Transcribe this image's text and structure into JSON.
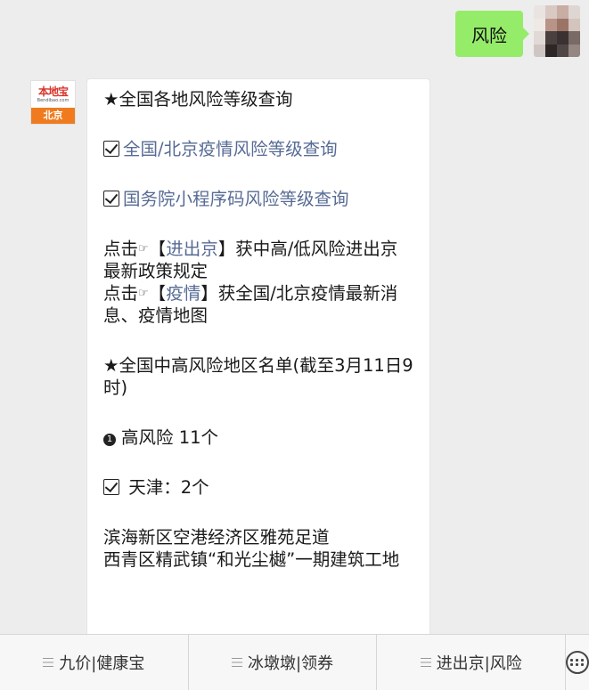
{
  "user_message": {
    "text": "风险"
  },
  "bot": {
    "avatar": {
      "logo_text": "本地宝",
      "logo_sub": "Bendibao.com",
      "city": "北京"
    },
    "message": {
      "title1": "★全国各地风险等级查询",
      "link1": "全国/北京疫情风险等级查询",
      "link2": "国务院小程序码风险等级查询",
      "click1_prefix": "点击",
      "click1_open": "【",
      "click1_link": "进出京",
      "click1_close": "】",
      "click1_rest": "获中高/低风险进出京最新政策规定",
      "click2_prefix": "点击",
      "click2_open": "【",
      "click2_link": "疫情",
      "click2_close": "】",
      "click2_rest": "获全国/北京疫情最新消息、疫情地图",
      "title2": "★全国中高风险地区名单(截至3月11日9时)",
      "high_risk_num": "1",
      "high_risk": "高风险 11个",
      "tianjin": "天津：2个",
      "place1": "滨海新区空港经济区雅苑足道",
      "place2": "西青区精武镇“和光尘樾”一期建筑工地"
    }
  },
  "menu": {
    "items": [
      {
        "label": "九价|健康宝"
      },
      {
        "label": "冰墩墩|领券"
      },
      {
        "label": "进出京|风险"
      }
    ],
    "keyboard_icon": "keyboard-icon"
  },
  "colors": {
    "bubble_user": "#95ec69",
    "link": "#576b95",
    "logo_red": "#d7332a",
    "logo_orange": "#ef7b1e"
  }
}
